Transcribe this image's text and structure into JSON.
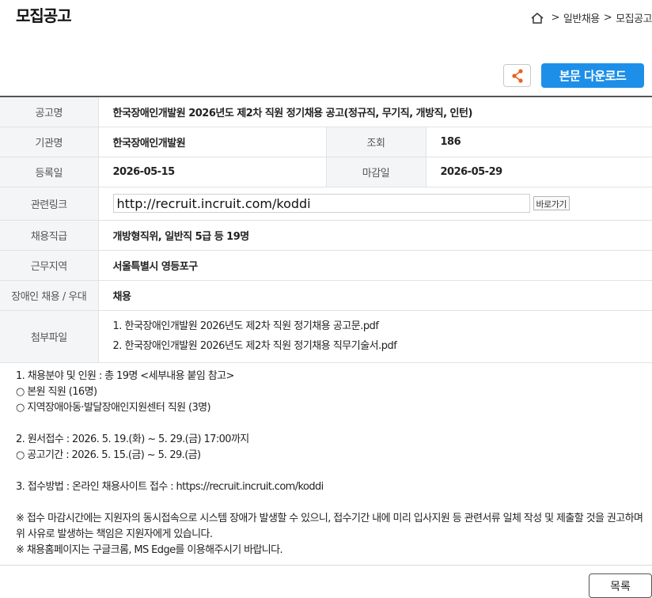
{
  "page_title": "모집공고",
  "breadcrumb": {
    "home_icon": "home-icon",
    "items": [
      "일반채용",
      "모집공고"
    ],
    "separator": ">"
  },
  "actions": {
    "share_icon": "share-icon",
    "download_label": "본문 다운로드",
    "list_label": "목록"
  },
  "info": {
    "title_label": "공고명",
    "title_value": "한국장애인개발원 2026년도 제2차 직원 정기채용 공고(정규직, 무기직, 개방직, 인턴)",
    "org_label": "기관명",
    "org_value": "한국장애인개발원",
    "views_label": "조회",
    "views_value": "186",
    "reg_label": "등록일",
    "reg_value": "2026-05-15",
    "deadline_label": "마감일",
    "deadline_value": "2026-05-29",
    "link_label": "관련링크",
    "link_value": "http://recruit.incruit.com/koddi",
    "goto_label": "바로가기",
    "job_label": "채용직급",
    "job_value": "개방형직위, 일반직 5급 등 19명",
    "area_label": "근무지역",
    "area_value": "서울특별시 영등포구",
    "disabled_label": "장애인 채용 / 우대",
    "disabled_value": "채용",
    "files_label": "첨부파일",
    "files": [
      "1. 한국장애인개발원 2026년도 제2차 직원 정기채용 공고문.pdf",
      "2. 한국장애인개발원 2026년도 제2차 직원 정기채용 직무기술서.pdf"
    ]
  },
  "body": {
    "l1": "1. 채용분야 및 인원 : 총 19명 <세부내용 붙임 참고>",
    "l2": "○ 본원 직원 (16명)",
    "l3": "○ 지역장애아동·발달장애인지원센터 직원 (3명)",
    "l4": "2. 원서접수 : 2026. 5. 19.(화) ~ 5. 29.(금) 17:00까지",
    "l5": "○ 공고기간 : 2026. 5. 15.(금) ~ 5. 29.(금)",
    "l6": "3. 접수방법 : 온라인 채용사이트 접수 : https://recruit.incruit.com/koddi",
    "l7": " ※ 접수 마감시간에는 지원자의 동시접속으로 시스템 장애가 발생할 수 있으니, 접수기간 내에 미리 입사지원 등 관련서류 일체 작성 및 제출할 것을 권고하며 위 사유로 발생하는 책임은 지원자에게 있습니다.",
    "l8": " ※ 채용홈페이지는 구글크롬, MS Edge를 이용해주시기 바랍니다."
  }
}
